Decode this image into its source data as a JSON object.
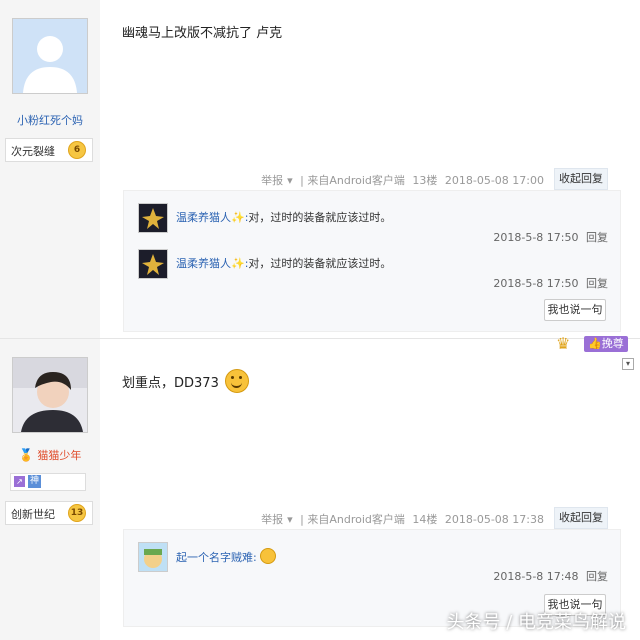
{
  "post1": {
    "username": "小粉红死个妈",
    "badge_label": "次元裂缝",
    "level": "6",
    "content": "幽魂马上改版不减抗了 卢克",
    "tail": {
      "report": "举报",
      "source": "| 来自Android客户端",
      "floor": "13楼",
      "time": "2018-05-08 17:00",
      "fold": "收起回复"
    },
    "replies": [
      {
        "user": "温柔养猫人",
        "sep": ":",
        "text": "对，过时的装备就应该过时。",
        "time": "2018-5-8 17:50",
        "reply": "回复"
      },
      {
        "user": "温柔养猫人",
        "sep": ":",
        "text": "对，过时的装备就应该过时。",
        "time": "2018-5-8 17:50",
        "reply": "回复"
      }
    ],
    "say_button": "我也说一句"
  },
  "post2": {
    "username": "猫猫少年",
    "tag_label": "神",
    "badge_label": "创新世纪",
    "level": "13",
    "content": "划重点，DD373",
    "tail": {
      "report": "举报",
      "source": "| 来自Android客户端",
      "floor": "14楼",
      "time": "2018-05-08 17:38",
      "fold": "收起回复"
    },
    "replies": [
      {
        "user": "起一个名字贼难",
        "sep": ":",
        "text": "",
        "time": "2018-5-8 17:48",
        "reply": "回复"
      }
    ],
    "say_button": "我也说一句"
  },
  "recommend_label": "挽尊",
  "watermark": "头条号 / 电竞菜鸟解说",
  "colors": {
    "link": "#2d64b3",
    "panel": "#f7f8fa",
    "badge_gold": "#f6c642",
    "recommend": "#9a6fd6"
  }
}
